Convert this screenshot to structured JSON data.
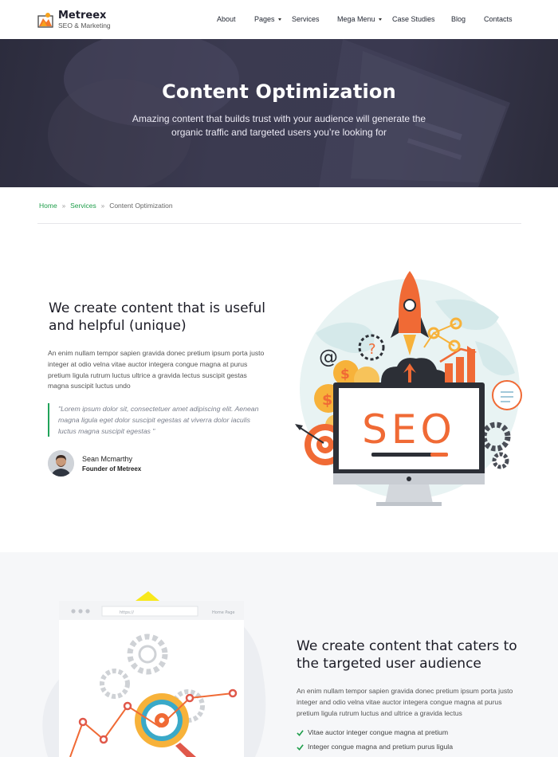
{
  "brand": {
    "name": "Metreex",
    "tagline": "SEO & Marketing",
    "accent": "#f2772c",
    "green": "#1e9e4a"
  },
  "nav": {
    "items": [
      {
        "label": "About",
        "has_caret": false
      },
      {
        "label": "Pages",
        "has_caret": true
      },
      {
        "label": "Services",
        "has_caret": false
      },
      {
        "label": "Mega Menu",
        "has_caret": true
      },
      {
        "label": "Case Studies",
        "has_caret": false
      },
      {
        "label": "Blog",
        "has_caret": false
      },
      {
        "label": "Contacts",
        "has_caret": false
      }
    ]
  },
  "hero": {
    "title": "Content Optimization",
    "subtitle": "Amazing content that builds trust with your audience will generate the organic traffic and targeted users you’re looking for"
  },
  "breadcrumb": {
    "home": "Home",
    "sep": "»",
    "services": "Services",
    "current": "Content Optimization"
  },
  "section1": {
    "title": "We create content that is useful and helpful (unique)",
    "body": "An enim nullam tempor sapien gravida donec pretium ipsum porta justo integer at odio velna vitae auctor integera congue magna at purus pretium ligula rutrum luctus ultrice a gravida lectus suscipit gestas magna suscipit luctus undo",
    "quote": "\"Lorem ipsum dolor sit, consectetuer amet adipiscing elit. Aenean magna ligula eget dolor suscipit egestas at viverra dolor iaculis luctus magna suscipit egestas \"",
    "author_name": "Sean Mcmarthy",
    "author_role": "Founder of Metreex",
    "art_text": "SEO"
  },
  "section2": {
    "title": "We create content that caters to the targeted user audience",
    "body": "An enim nullam tempor sapien gravida donec pretium ipsum porta justo integer and odio velna vitae auctor integera congue magna at purus pretium ligula rutrum luctus and ultrice a gravida lectus",
    "list": [
      "Vitae auctor integer congue magna at pretium",
      "Integer congue magna and pretium purus ligula"
    ],
    "browser_url": "https://",
    "browser_tab": "Home Page"
  }
}
